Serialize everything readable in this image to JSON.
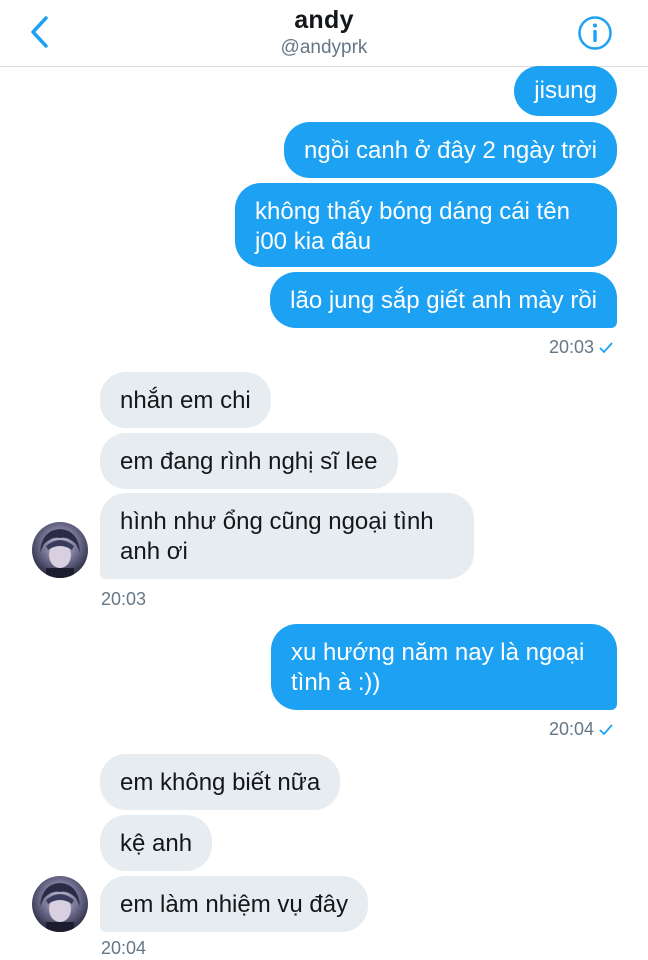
{
  "header": {
    "name": "andy",
    "handle": "@andyprk",
    "back_icon": "chevron-left-icon",
    "info_icon": "info-icon"
  },
  "groups": [
    {
      "direction": "outgoing",
      "messages": [
        "jisung",
        "ngồi canh ở đây 2 ngày trời",
        "không thấy bóng dáng cái tên\nj00 kia đâu",
        "lão jung sắp giết anh mày rồi"
      ],
      "time": "20:03",
      "read_receipt": true
    },
    {
      "direction": "incoming",
      "messages": [
        "nhắn em chi",
        "em đang rình nghị sĩ lee",
        "hình như ổng cũng ngoại tình\nanh ơi"
      ],
      "time": "20:03"
    },
    {
      "direction": "outgoing",
      "messages": [
        "xu hướng năm nay là ngoại\ntình à :))"
      ],
      "time": "20:04",
      "read_receipt": true
    },
    {
      "direction": "incoming",
      "messages": [
        "em không biết nữa",
        "kệ anh",
        "em làm nhiệm vụ đây"
      ],
      "time": "20:04"
    }
  ],
  "colors": {
    "accent": "#1da1f2",
    "incoming_bubble": "#e6ecf0",
    "secondary_text": "#657786"
  }
}
